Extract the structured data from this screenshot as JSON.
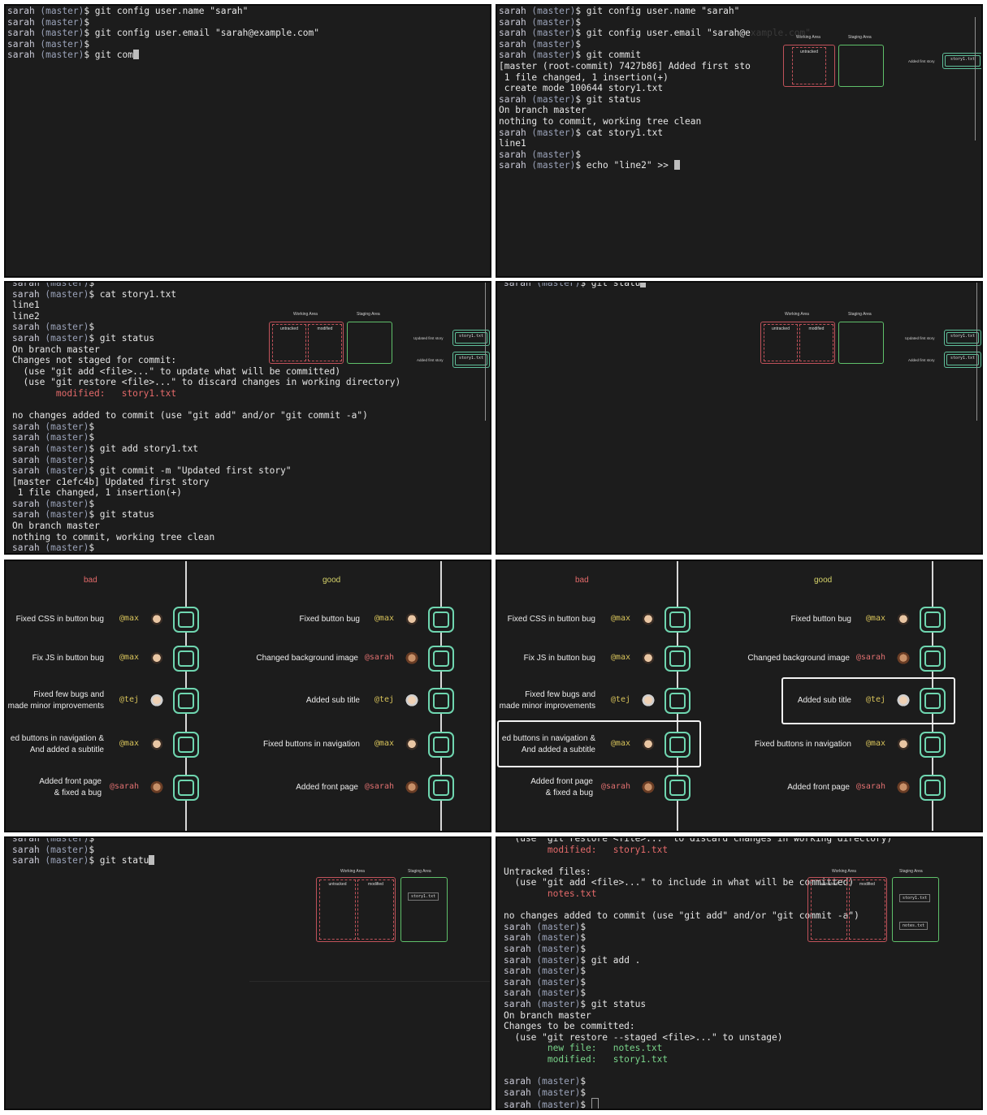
{
  "prompt": {
    "user": "sarah",
    "branch": "(master)",
    "symbol": "$"
  },
  "panel1": {
    "lines": [
      [
        "p",
        " git config user.name \"sarah\""
      ],
      [
        "p",
        ""
      ],
      [
        "p",
        " git config user.email \"sarah@example.com\""
      ],
      [
        "p",
        ""
      ],
      [
        "p",
        " git com",
        "cursor"
      ]
    ]
  },
  "panel2": {
    "lines": [
      [
        "p",
        " git config user.name \"sarah\""
      ],
      [
        "p",
        ""
      ],
      [
        "p",
        " git config user.email \"sarah@e"
      ],
      [
        "p",
        ""
      ],
      [
        "p",
        " git commit"
      ],
      [
        "t",
        "[master (root-commit) 7427b86] Added first sto"
      ],
      [
        "t",
        " 1 file changed, 1 insertion(+)"
      ],
      [
        "t",
        " create mode 100644 story1.txt"
      ],
      [
        "p",
        " git status"
      ],
      [
        "t",
        "On branch master"
      ],
      [
        "t",
        "nothing to commit, working tree clean"
      ],
      [
        "p",
        " cat story1.txt"
      ],
      [
        "t",
        "line1"
      ],
      [
        "p",
        ""
      ],
      [
        "p",
        " echo \"line2\" >> ",
        "cursor"
      ]
    ],
    "faded_tail": "xample.com\""
  },
  "panel3": {
    "lines": [
      [
        "p",
        ""
      ],
      [
        "p",
        " cat story1.txt"
      ],
      [
        "t",
        "line1"
      ],
      [
        "t",
        "line2"
      ],
      [
        "p",
        ""
      ],
      [
        "p",
        " git status"
      ],
      [
        "t",
        "On branch master"
      ],
      [
        "t",
        "Changes not staged for commit:"
      ],
      [
        "t",
        "  (use \"git add <file>...\" to update what will be committed)"
      ],
      [
        "t",
        "  (use \"git restore <file>...\" to discard changes in working directory)"
      ],
      [
        "r",
        "        modified:   story1.txt"
      ],
      [
        "t",
        ""
      ],
      [
        "t",
        "no changes added to commit (use \"git add\" and/or \"git commit -a\")"
      ],
      [
        "p",
        ""
      ],
      [
        "p",
        ""
      ],
      [
        "p",
        " git add story1.txt"
      ],
      [
        "p",
        ""
      ],
      [
        "p",
        " git commit -m \"Updated first story\""
      ],
      [
        "t",
        "[master c1efc4b] Updated first story"
      ],
      [
        "t",
        " 1 file changed, 1 insertion(+)"
      ],
      [
        "p",
        ""
      ],
      [
        "p",
        " git status"
      ],
      [
        "t",
        "On branch master"
      ],
      [
        "t",
        "nothing to commit, working tree clean"
      ],
      [
        "p",
        ""
      ],
      [
        "p",
        " ",
        "cursor"
      ]
    ]
  },
  "panel4": {
    "lines": [
      [
        "p",
        " git statu",
        "cursor"
      ]
    ]
  },
  "panel7": {
    "lines": [
      [
        "p",
        ""
      ],
      [
        "p",
        ""
      ],
      [
        "p",
        " git statu",
        "cursor"
      ]
    ]
  },
  "panel8": {
    "lines": [
      [
        "t",
        "  (use \"git restore <file>...\" to discard changes in working directory)"
      ],
      [
        "r",
        "        modified:   story1.txt"
      ],
      [
        "t",
        ""
      ],
      [
        "t",
        "Untracked files:"
      ],
      [
        "t",
        "  (use \"git add <file>...\" to include in what will be committed)"
      ],
      [
        "r",
        "        notes.txt"
      ],
      [
        "t",
        ""
      ],
      [
        "t",
        "no changes added to commit (use \"git add\" and/or \"git commit -a\")"
      ],
      [
        "p",
        ""
      ],
      [
        "p",
        ""
      ],
      [
        "p",
        ""
      ],
      [
        "p",
        " git add ."
      ],
      [
        "p",
        ""
      ],
      [
        "p",
        ""
      ],
      [
        "p",
        ""
      ],
      [
        "p",
        " git status"
      ],
      [
        "t",
        "On branch master"
      ],
      [
        "t",
        "Changes to be committed:"
      ],
      [
        "t",
        "  (use \"git restore --staged <file>...\" to unstage)"
      ],
      [
        "g",
        "        new file:   notes.txt"
      ],
      [
        "g",
        "        modified:   story1.txt"
      ],
      [
        "t",
        ""
      ],
      [
        "p",
        ""
      ],
      [
        "p",
        ""
      ],
      [
        "p",
        " ",
        "hollow"
      ]
    ]
  },
  "diagram": {
    "working_area": "Working Area",
    "staging_area": "Staging Area",
    "untracked": "untracked",
    "modified": "modified",
    "story1": "story1.txt",
    "notes": "notes.txt",
    "added_first_story": "Added first story",
    "updated_first_story": "Updated first story"
  },
  "history": {
    "bad_label": "bad",
    "good_label": "good",
    "bad": [
      {
        "msg": "Fixed CSS in button bug",
        "author": "@max",
        "who": "max"
      },
      {
        "msg": "Fix JS in button bug",
        "author": "@max",
        "who": "max"
      },
      {
        "msg": "Fixed few bugs and\nmade minor improvements",
        "author": "@tej",
        "who": "tej"
      },
      {
        "msg": "ed buttons in navigation &\nAnd added a subtitle",
        "author": "@max",
        "who": "max"
      },
      {
        "msg": "Added front page\n& fixed a bug",
        "author": "@sarah",
        "who": "sarah"
      }
    ],
    "good": [
      {
        "msg": "Fixed button bug",
        "author": "@max",
        "who": "max"
      },
      {
        "msg": "Changed background image",
        "author": "@sarah",
        "who": "sarah"
      },
      {
        "msg": "Added sub title",
        "author": "@tej",
        "who": "tej"
      },
      {
        "msg": "Fixed buttons in navigation",
        "author": "@max",
        "who": "max"
      },
      {
        "msg": "Added front page",
        "author": "@sarah",
        "who": "sarah"
      }
    ]
  }
}
